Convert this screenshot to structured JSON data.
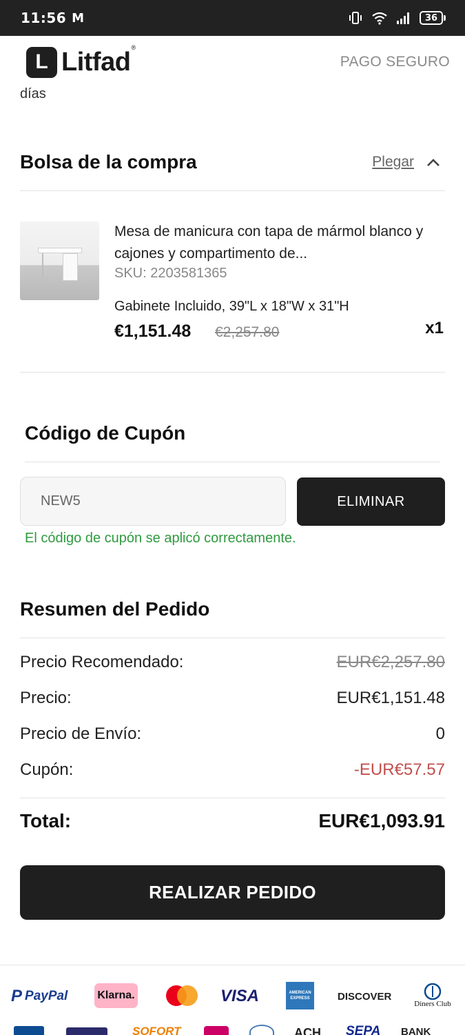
{
  "status_bar": {
    "time": "11:56",
    "mail_glyph": "M",
    "battery": "36"
  },
  "header": {
    "logo_letter": "L",
    "logo_text": "Litfad",
    "logo_reg": "®",
    "secure_label": "PAGO SEGURO"
  },
  "truncated_text": "días",
  "bag": {
    "title": "Bolsa de la compra",
    "fold_label": "Plegar",
    "product": {
      "name": "Mesa de manicura con tapa de mármol blanco y cajones y compartimento de...",
      "sku": "SKU: 2203581365",
      "variant": "Gabinete Incluido, 39\"L x 18\"W x 31\"H",
      "price": "€1,151.48",
      "old_price": "€2,257.80",
      "quantity": "x1"
    }
  },
  "coupon": {
    "title": "Código de Cupón",
    "input_value": "NEW5",
    "button_label": "ELIMINAR",
    "success_message": "El código de cupón se aplicó correctamente."
  },
  "summary": {
    "title": "Resumen del Pedido",
    "rows": [
      {
        "label": "Precio Recomendado:",
        "value": "EUR€2,257.80"
      },
      {
        "label": "Precio:",
        "value": "EUR€1,151.48"
      },
      {
        "label": "Precio de Envío:",
        "value": "0"
      },
      {
        "label": "Cupón:",
        "value": "-EUR€57.57"
      }
    ],
    "total_label": "Total:",
    "total_value": "EUR€1,093.91"
  },
  "order_button": "REALIZAR PEDIDO",
  "payment_methods": {
    "paypal": "PayPal",
    "klarna": "Klarna.",
    "visa": "VISA",
    "amex": "AMERICAN EXPRESS",
    "discover": "DISCOVER",
    "diners": "Diners Club",
    "sofort": "SOFORT",
    "ach": "ACH",
    "sepa": "SEPA",
    "bank": "BANK"
  },
  "colors": {
    "dark": "#1f1f1f",
    "success": "#2f9a3f",
    "discount": "#c0504d",
    "muted": "#8a8a8a"
  }
}
